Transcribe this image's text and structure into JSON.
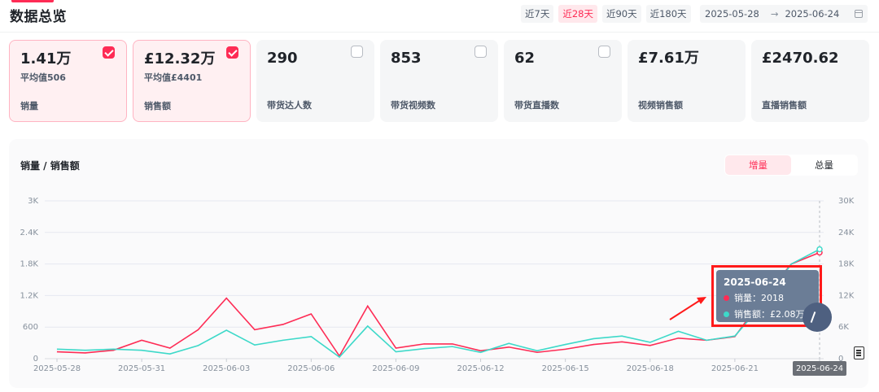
{
  "title": "数据总览",
  "range_buttons": [
    "近7天",
    "近28天",
    "近90天",
    "近180天"
  ],
  "active_range": "近28天",
  "date_range": {
    "start": "2025-05-28",
    "arrow": "→",
    "end": "2025-06-24"
  },
  "cards": [
    {
      "value": "1.41万",
      "sub": "平均值506",
      "label": "销量",
      "checked": true
    },
    {
      "value": "£12.32万",
      "sub": "平均值£4401",
      "label": "销售额",
      "checked": true
    },
    {
      "value": "290",
      "sub": "",
      "label": "带货达人数",
      "checked": false
    },
    {
      "value": "853",
      "sub": "",
      "label": "带货视频数",
      "checked": false
    },
    {
      "value": "62",
      "sub": "",
      "label": "带货直播数",
      "checked": false
    },
    {
      "value": "£7.61万",
      "sub": "",
      "label": "视频销售额",
      "checked": null
    },
    {
      "value": "£2470.62",
      "sub": "",
      "label": "直播销售额",
      "checked": null
    }
  ],
  "chart_panel": {
    "title": "销量 / 销售额",
    "toggle": [
      "增量",
      "总量"
    ],
    "active_toggle": "增量"
  },
  "tooltip": {
    "date": "2025-06-24",
    "rows": [
      {
        "label": "销量：2018",
        "color": "#fe2c55"
      },
      {
        "label": "销售额：£2.08万",
        "color": "#3dd9c9"
      }
    ]
  },
  "x_highlight_label": "2025-06-24",
  "chart_data": {
    "type": "line",
    "title": "销量 / 销售额",
    "x": [
      "2025-05-28",
      "2025-05-29",
      "2025-05-30",
      "2025-05-31",
      "2025-06-01",
      "2025-06-02",
      "2025-06-03",
      "2025-06-04",
      "2025-06-05",
      "2025-06-06",
      "2025-06-07",
      "2025-06-08",
      "2025-06-09",
      "2025-06-10",
      "2025-06-11",
      "2025-06-12",
      "2025-06-13",
      "2025-06-14",
      "2025-06-15",
      "2025-06-16",
      "2025-06-17",
      "2025-06-18",
      "2025-06-19",
      "2025-06-20",
      "2025-06-21",
      "2025-06-22",
      "2025-06-23",
      "2025-06-24"
    ],
    "x_tick_labels": [
      "2025-05-28",
      "2025-05-31",
      "2025-06-03",
      "2025-06-06",
      "2025-06-09",
      "2025-06-12",
      "2025-06-15",
      "2025-06-18",
      "2025-06-21",
      "2025-06-24"
    ],
    "y_left": {
      "ticks": [
        "0",
        "600",
        "1.2K",
        "1.8K",
        "2.4K",
        "3K"
      ],
      "range": [
        0,
        3000
      ]
    },
    "y_right": {
      "ticks": [
        "0",
        "6K",
        "12K",
        "18K",
        "24K",
        "30K"
      ],
      "range": [
        0,
        30000
      ]
    },
    "grid": true,
    "series": [
      {
        "name": "销量",
        "axis": "left",
        "color": "#fe2c55",
        "values": [
          130,
          110,
          160,
          350,
          200,
          550,
          1150,
          550,
          650,
          850,
          50,
          1000,
          200,
          280,
          280,
          150,
          220,
          120,
          180,
          270,
          320,
          250,
          390,
          350,
          420,
          1150,
          1800,
          2018
        ]
      },
      {
        "name": "销售额",
        "axis": "right",
        "color": "#3dd9c9",
        "values": [
          1800,
          1600,
          1800,
          1600,
          900,
          2500,
          5400,
          2600,
          3500,
          4200,
          300,
          6200,
          1300,
          1900,
          2300,
          1200,
          2900,
          1500,
          2700,
          3800,
          4300,
          3100,
          5200,
          3500,
          4300,
          10500,
          18000,
          20800
        ]
      }
    ]
  }
}
